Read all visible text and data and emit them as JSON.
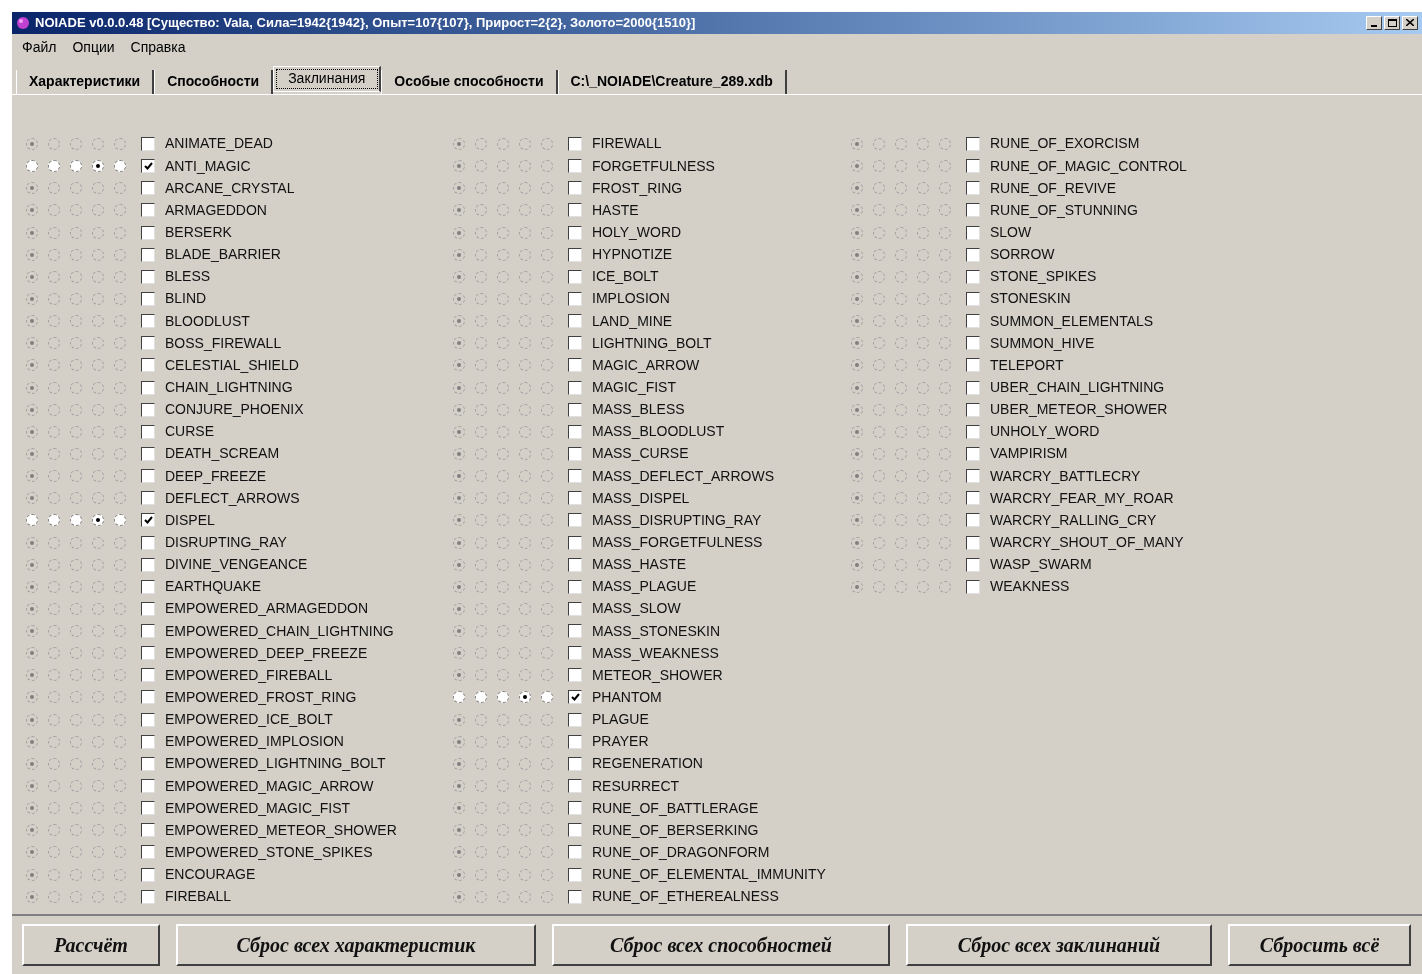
{
  "window": {
    "title": "NOIADE v0.0.0.48 [Существо: Vala, Сила=1942{1942}, Опыт=107{107}, Прирост=2{2}, Золото=2000{1510}]"
  },
  "menu": [
    "Файл",
    "Опции",
    "Справка"
  ],
  "tabs": [
    {
      "label": "Характеристики",
      "selected": false
    },
    {
      "label": "Способности",
      "selected": false
    },
    {
      "label": "Заклинания",
      "selected": true
    },
    {
      "label": "Особые способности",
      "selected": false
    },
    {
      "label": "C:\\_NOIADE\\Creature_289.xdb",
      "selected": false
    }
  ],
  "spell_columns": [
    [
      {
        "name": "ANIMATE_DEAD",
        "checked": false,
        "disabled": true,
        "radios": [
          true,
          false,
          false,
          false,
          false
        ]
      },
      {
        "name": "ANTI_MAGIC",
        "checked": true,
        "disabled": false,
        "radios": [
          false,
          false,
          false,
          true,
          false
        ]
      },
      {
        "name": "ARCANE_CRYSTAL",
        "checked": false,
        "disabled": true,
        "radios": [
          true,
          false,
          false,
          false,
          false
        ]
      },
      {
        "name": "ARMAGEDDON",
        "checked": false,
        "disabled": true,
        "radios": [
          true,
          false,
          false,
          false,
          false
        ]
      },
      {
        "name": "BERSERK",
        "checked": false,
        "disabled": true,
        "radios": [
          true,
          false,
          false,
          false,
          false
        ]
      },
      {
        "name": "BLADE_BARRIER",
        "checked": false,
        "disabled": true,
        "radios": [
          true,
          false,
          false,
          false,
          false
        ]
      },
      {
        "name": "BLESS",
        "checked": false,
        "disabled": true,
        "radios": [
          true,
          false,
          false,
          false,
          false
        ]
      },
      {
        "name": "BLIND",
        "checked": false,
        "disabled": true,
        "radios": [
          true,
          false,
          false,
          false,
          false
        ]
      },
      {
        "name": "BLOODLUST",
        "checked": false,
        "disabled": true,
        "radios": [
          true,
          false,
          false,
          false,
          false
        ]
      },
      {
        "name": "BOSS_FIREWALL",
        "checked": false,
        "disabled": true,
        "radios": [
          true,
          false,
          false,
          false,
          false
        ]
      },
      {
        "name": "CELESTIAL_SHIELD",
        "checked": false,
        "disabled": true,
        "radios": [
          true,
          false,
          false,
          false,
          false
        ]
      },
      {
        "name": "CHAIN_LIGHTNING",
        "checked": false,
        "disabled": true,
        "radios": [
          true,
          false,
          false,
          false,
          false
        ]
      },
      {
        "name": "CONJURE_PHOENIX",
        "checked": false,
        "disabled": true,
        "radios": [
          true,
          false,
          false,
          false,
          false
        ]
      },
      {
        "name": "CURSE",
        "checked": false,
        "disabled": true,
        "radios": [
          true,
          false,
          false,
          false,
          false
        ]
      },
      {
        "name": "DEATH_SCREAM",
        "checked": false,
        "disabled": true,
        "radios": [
          true,
          false,
          false,
          false,
          false
        ]
      },
      {
        "name": "DEEP_FREEZE",
        "checked": false,
        "disabled": true,
        "radios": [
          true,
          false,
          false,
          false,
          false
        ]
      },
      {
        "name": "DEFLECT_ARROWS",
        "checked": false,
        "disabled": true,
        "radios": [
          true,
          false,
          false,
          false,
          false
        ]
      },
      {
        "name": "DISPEL",
        "checked": true,
        "disabled": false,
        "radios": [
          false,
          false,
          false,
          true,
          false
        ]
      },
      {
        "name": "DISRUPTING_RAY",
        "checked": false,
        "disabled": true,
        "radios": [
          true,
          false,
          false,
          false,
          false
        ]
      },
      {
        "name": "DIVINE_VENGEANCE",
        "checked": false,
        "disabled": true,
        "radios": [
          true,
          false,
          false,
          false,
          false
        ]
      },
      {
        "name": "EARTHQUAKE",
        "checked": false,
        "disabled": true,
        "radios": [
          true,
          false,
          false,
          false,
          false
        ]
      },
      {
        "name": "EMPOWERED_ARMAGEDDON",
        "checked": false,
        "disabled": true,
        "radios": [
          true,
          false,
          false,
          false,
          false
        ]
      },
      {
        "name": "EMPOWERED_CHAIN_LIGHTNING",
        "checked": false,
        "disabled": true,
        "radios": [
          true,
          false,
          false,
          false,
          false
        ]
      },
      {
        "name": "EMPOWERED_DEEP_FREEZE",
        "checked": false,
        "disabled": true,
        "radios": [
          true,
          false,
          false,
          false,
          false
        ]
      },
      {
        "name": "EMPOWERED_FIREBALL",
        "checked": false,
        "disabled": true,
        "radios": [
          true,
          false,
          false,
          false,
          false
        ]
      },
      {
        "name": "EMPOWERED_FROST_RING",
        "checked": false,
        "disabled": true,
        "radios": [
          true,
          false,
          false,
          false,
          false
        ]
      },
      {
        "name": "EMPOWERED_ICE_BOLT",
        "checked": false,
        "disabled": true,
        "radios": [
          true,
          false,
          false,
          false,
          false
        ]
      },
      {
        "name": "EMPOWERED_IMPLOSION",
        "checked": false,
        "disabled": true,
        "radios": [
          true,
          false,
          false,
          false,
          false
        ]
      },
      {
        "name": "EMPOWERED_LIGHTNING_BOLT",
        "checked": false,
        "disabled": true,
        "radios": [
          true,
          false,
          false,
          false,
          false
        ]
      },
      {
        "name": "EMPOWERED_MAGIC_ARROW",
        "checked": false,
        "disabled": true,
        "radios": [
          true,
          false,
          false,
          false,
          false
        ]
      },
      {
        "name": "EMPOWERED_MAGIC_FIST",
        "checked": false,
        "disabled": true,
        "radios": [
          true,
          false,
          false,
          false,
          false
        ]
      },
      {
        "name": "EMPOWERED_METEOR_SHOWER",
        "checked": false,
        "disabled": true,
        "radios": [
          true,
          false,
          false,
          false,
          false
        ]
      },
      {
        "name": "EMPOWERED_STONE_SPIKES",
        "checked": false,
        "disabled": true,
        "radios": [
          true,
          false,
          false,
          false,
          false
        ]
      },
      {
        "name": "ENCOURAGE",
        "checked": false,
        "disabled": true,
        "radios": [
          true,
          false,
          false,
          false,
          false
        ]
      },
      {
        "name": "FIREBALL",
        "checked": false,
        "disabled": true,
        "radios": [
          true,
          false,
          false,
          false,
          false
        ]
      }
    ],
    [
      {
        "name": "FIREWALL",
        "checked": false,
        "disabled": true,
        "radios": [
          true,
          false,
          false,
          false,
          false
        ]
      },
      {
        "name": "FORGETFULNESS",
        "checked": false,
        "disabled": true,
        "radios": [
          true,
          false,
          false,
          false,
          false
        ]
      },
      {
        "name": "FROST_RING",
        "checked": false,
        "disabled": true,
        "radios": [
          true,
          false,
          false,
          false,
          false
        ]
      },
      {
        "name": "HASTE",
        "checked": false,
        "disabled": true,
        "radios": [
          true,
          false,
          false,
          false,
          false
        ]
      },
      {
        "name": "HOLY_WORD",
        "checked": false,
        "disabled": true,
        "radios": [
          true,
          false,
          false,
          false,
          false
        ]
      },
      {
        "name": "HYPNOTIZE",
        "checked": false,
        "disabled": true,
        "radios": [
          true,
          false,
          false,
          false,
          false
        ]
      },
      {
        "name": "ICE_BOLT",
        "checked": false,
        "disabled": true,
        "radios": [
          true,
          false,
          false,
          false,
          false
        ]
      },
      {
        "name": "IMPLOSION",
        "checked": false,
        "disabled": true,
        "radios": [
          true,
          false,
          false,
          false,
          false
        ]
      },
      {
        "name": "LAND_MINE",
        "checked": false,
        "disabled": true,
        "radios": [
          true,
          false,
          false,
          false,
          false
        ]
      },
      {
        "name": "LIGHTNING_BOLT",
        "checked": false,
        "disabled": true,
        "radios": [
          true,
          false,
          false,
          false,
          false
        ]
      },
      {
        "name": "MAGIC_ARROW",
        "checked": false,
        "disabled": true,
        "radios": [
          true,
          false,
          false,
          false,
          false
        ]
      },
      {
        "name": "MAGIC_FIST",
        "checked": false,
        "disabled": true,
        "radios": [
          true,
          false,
          false,
          false,
          false
        ]
      },
      {
        "name": "MASS_BLESS",
        "checked": false,
        "disabled": true,
        "radios": [
          true,
          false,
          false,
          false,
          false
        ]
      },
      {
        "name": "MASS_BLOODLUST",
        "checked": false,
        "disabled": true,
        "radios": [
          true,
          false,
          false,
          false,
          false
        ]
      },
      {
        "name": "MASS_CURSE",
        "checked": false,
        "disabled": true,
        "radios": [
          true,
          false,
          false,
          false,
          false
        ]
      },
      {
        "name": "MASS_DEFLECT_ARROWS",
        "checked": false,
        "disabled": true,
        "radios": [
          true,
          false,
          false,
          false,
          false
        ]
      },
      {
        "name": "MASS_DISPEL",
        "checked": false,
        "disabled": true,
        "radios": [
          true,
          false,
          false,
          false,
          false
        ]
      },
      {
        "name": "MASS_DISRUPTING_RAY",
        "checked": false,
        "disabled": true,
        "radios": [
          true,
          false,
          false,
          false,
          false
        ]
      },
      {
        "name": "MASS_FORGETFULNESS",
        "checked": false,
        "disabled": true,
        "radios": [
          true,
          false,
          false,
          false,
          false
        ]
      },
      {
        "name": "MASS_HASTE",
        "checked": false,
        "disabled": true,
        "radios": [
          true,
          false,
          false,
          false,
          false
        ]
      },
      {
        "name": "MASS_PLAGUE",
        "checked": false,
        "disabled": true,
        "radios": [
          true,
          false,
          false,
          false,
          false
        ]
      },
      {
        "name": "MASS_SLOW",
        "checked": false,
        "disabled": true,
        "radios": [
          true,
          false,
          false,
          false,
          false
        ]
      },
      {
        "name": "MASS_STONESKIN",
        "checked": false,
        "disabled": true,
        "radios": [
          true,
          false,
          false,
          false,
          false
        ]
      },
      {
        "name": "MASS_WEAKNESS",
        "checked": false,
        "disabled": true,
        "radios": [
          true,
          false,
          false,
          false,
          false
        ]
      },
      {
        "name": "METEOR_SHOWER",
        "checked": false,
        "disabled": true,
        "radios": [
          true,
          false,
          false,
          false,
          false
        ]
      },
      {
        "name": "PHANTOM",
        "checked": true,
        "disabled": false,
        "radios": [
          false,
          false,
          false,
          true,
          false
        ]
      },
      {
        "name": "PLAGUE",
        "checked": false,
        "disabled": true,
        "radios": [
          true,
          false,
          false,
          false,
          false
        ]
      },
      {
        "name": "PRAYER",
        "checked": false,
        "disabled": true,
        "radios": [
          true,
          false,
          false,
          false,
          false
        ]
      },
      {
        "name": "REGENERATION",
        "checked": false,
        "disabled": true,
        "radios": [
          true,
          false,
          false,
          false,
          false
        ]
      },
      {
        "name": "RESURRECT",
        "checked": false,
        "disabled": true,
        "radios": [
          true,
          false,
          false,
          false,
          false
        ]
      },
      {
        "name": "RUNE_OF_BATTLERAGE",
        "checked": false,
        "disabled": true,
        "radios": [
          true,
          false,
          false,
          false,
          false
        ]
      },
      {
        "name": "RUNE_OF_BERSERKING",
        "checked": false,
        "disabled": true,
        "radios": [
          true,
          false,
          false,
          false,
          false
        ]
      },
      {
        "name": "RUNE_OF_DRAGONFORM",
        "checked": false,
        "disabled": true,
        "radios": [
          true,
          false,
          false,
          false,
          false
        ]
      },
      {
        "name": "RUNE_OF_ELEMENTAL_IMMUNITY",
        "checked": false,
        "disabled": true,
        "radios": [
          true,
          false,
          false,
          false,
          false
        ]
      },
      {
        "name": "RUNE_OF_ETHEREALNESS",
        "checked": false,
        "disabled": true,
        "radios": [
          true,
          false,
          false,
          false,
          false
        ]
      }
    ],
    [
      {
        "name": "RUNE_OF_EXORCISM",
        "checked": false,
        "disabled": true,
        "radios": [
          true,
          false,
          false,
          false,
          false
        ]
      },
      {
        "name": "RUNE_OF_MAGIC_CONTROL",
        "checked": false,
        "disabled": true,
        "radios": [
          true,
          false,
          false,
          false,
          false
        ]
      },
      {
        "name": "RUNE_OF_REVIVE",
        "checked": false,
        "disabled": true,
        "radios": [
          true,
          false,
          false,
          false,
          false
        ]
      },
      {
        "name": "RUNE_OF_STUNNING",
        "checked": false,
        "disabled": true,
        "radios": [
          true,
          false,
          false,
          false,
          false
        ]
      },
      {
        "name": "SLOW",
        "checked": false,
        "disabled": true,
        "radios": [
          true,
          false,
          false,
          false,
          false
        ]
      },
      {
        "name": "SORROW",
        "checked": false,
        "disabled": true,
        "radios": [
          true,
          false,
          false,
          false,
          false
        ]
      },
      {
        "name": "STONE_SPIKES",
        "checked": false,
        "disabled": true,
        "radios": [
          true,
          false,
          false,
          false,
          false
        ]
      },
      {
        "name": "STONESKIN",
        "checked": false,
        "disabled": true,
        "radios": [
          true,
          false,
          false,
          false,
          false
        ]
      },
      {
        "name": "SUMMON_ELEMENTALS",
        "checked": false,
        "disabled": true,
        "radios": [
          true,
          false,
          false,
          false,
          false
        ]
      },
      {
        "name": "SUMMON_HIVE",
        "checked": false,
        "disabled": true,
        "radios": [
          true,
          false,
          false,
          false,
          false
        ]
      },
      {
        "name": "TELEPORT",
        "checked": false,
        "disabled": true,
        "radios": [
          true,
          false,
          false,
          false,
          false
        ]
      },
      {
        "name": "UBER_CHAIN_LIGHTNING",
        "checked": false,
        "disabled": true,
        "radios": [
          true,
          false,
          false,
          false,
          false
        ]
      },
      {
        "name": "UBER_METEOR_SHOWER",
        "checked": false,
        "disabled": true,
        "radios": [
          true,
          false,
          false,
          false,
          false
        ]
      },
      {
        "name": "UNHOLY_WORD",
        "checked": false,
        "disabled": true,
        "radios": [
          true,
          false,
          false,
          false,
          false
        ]
      },
      {
        "name": "VAMPIRISM",
        "checked": false,
        "disabled": true,
        "radios": [
          true,
          false,
          false,
          false,
          false
        ]
      },
      {
        "name": "WARCRY_BATTLECRY",
        "checked": false,
        "disabled": true,
        "radios": [
          true,
          false,
          false,
          false,
          false
        ]
      },
      {
        "name": "WARCRY_FEAR_MY_ROAR",
        "checked": false,
        "disabled": true,
        "radios": [
          true,
          false,
          false,
          false,
          false
        ]
      },
      {
        "name": "WARCRY_RALLING_CRY",
        "checked": false,
        "disabled": true,
        "radios": [
          true,
          false,
          false,
          false,
          false
        ]
      },
      {
        "name": "WARCRY_SHOUT_OF_MANY",
        "checked": false,
        "disabled": true,
        "radios": [
          true,
          false,
          false,
          false,
          false
        ]
      },
      {
        "name": "WASP_SWARM",
        "checked": false,
        "disabled": true,
        "radios": [
          true,
          false,
          false,
          false,
          false
        ]
      },
      {
        "name": "WEAKNESS",
        "checked": false,
        "disabled": true,
        "radios": [
          true,
          false,
          false,
          false,
          false
        ]
      }
    ]
  ],
  "buttons": [
    "Рассчёт",
    "Сброс всех характеристик",
    "Сброс всех способностей",
    "Сброс всех заклинаний",
    "Сбросить всё"
  ]
}
